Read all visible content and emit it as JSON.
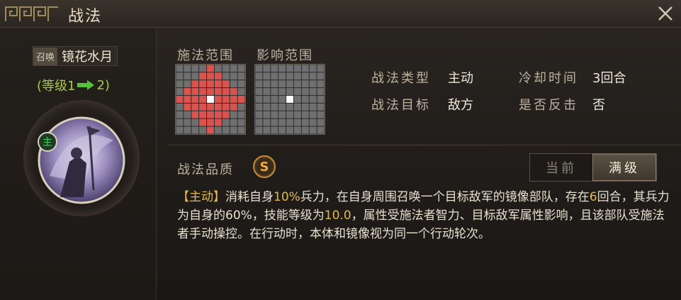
{
  "window": {
    "title": "战法"
  },
  "left": {
    "summon_tag": "召唤",
    "skill_name": "镜花水月",
    "level_prefix": "(等级1",
    "level_suffix": "2)",
    "role_badge": "主"
  },
  "ranges": {
    "cast_label": "施法范围",
    "effect_label": "影响范围"
  },
  "info": {
    "type_label": "战法类型",
    "type_value": "主动",
    "cooldown_label": "冷却时间",
    "cooldown_value": "3回合",
    "target_label": "战法目标",
    "target_value": "敌方",
    "counter_label": "是否反击",
    "counter_value": "否"
  },
  "quality": {
    "label": "战法品质",
    "grade": "S"
  },
  "toggle": {
    "current": "当前",
    "max": "满级"
  },
  "description": {
    "tag": "【主动】",
    "p1": "消耗自身",
    "v1": "10%",
    "p2": "兵力，在自身周围召唤一个目标敌军的镜像部队，存在",
    "v2": "6",
    "p3": "回合，其兵力为自身的60%，技能等级为",
    "v3": "10.0",
    "p4": "，属性受施法者智力、目标敌军属性影响，且该部队受施法者手动操控。在行动时，本体和镜像视为同一个行动轮次。"
  },
  "colors": {
    "accent_gold": "#e6b84a",
    "level_green": "#a8c84a",
    "range_red": "#d9534f"
  },
  "icons": {
    "close": "close-icon",
    "arrow": "arrow-right-icon",
    "ornament": "title-ornament-icon",
    "portrait": "general-portrait"
  }
}
